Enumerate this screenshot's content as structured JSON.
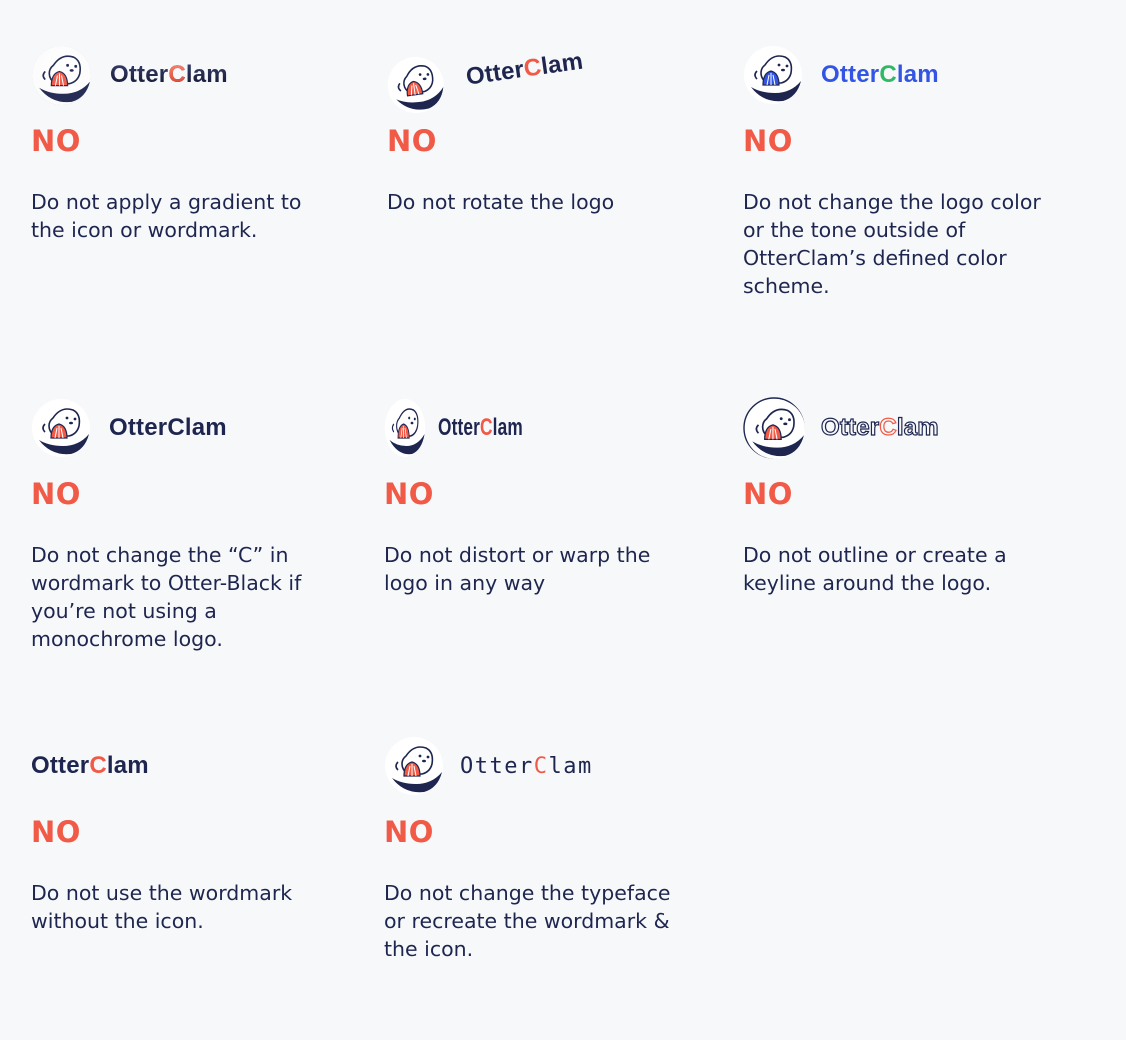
{
  "brand": {
    "wordmark_prefix": "Otter",
    "wordmark_c": "C",
    "wordmark_suffix": "lam",
    "colors": {
      "navy": "#1e2650",
      "coral": "#f05a46",
      "background": "#f7f8fa"
    }
  },
  "rules": [
    {
      "label": "NO",
      "description": "Do not apply a gradient to the icon or wordmark.",
      "icon": "otter-clam-icon"
    },
    {
      "label": "NO",
      "description": "Do not rotate the logo",
      "icon": "otter-clam-icon"
    },
    {
      "label": "NO",
      "description": "Do not change the logo color or the tone outside of OtterClam’s defined color scheme.",
      "icon": "otter-clam-icon"
    },
    {
      "label": "NO",
      "description": "Do not change the “C” in wordmark to Otter-Black if you’re not using a monochrome logo.",
      "icon": "otter-clam-icon"
    },
    {
      "label": "NO",
      "description": "Do not distort or warp the logo in any way",
      "icon": "otter-clam-icon"
    },
    {
      "label": "NO",
      "description": "Do not outline or create a keyline around the logo.",
      "icon": "otter-clam-icon"
    },
    {
      "label": "NO",
      "description": "Do not use the wordmark without the icon."
    },
    {
      "label": "NO",
      "description": "Do not change the typeface or recreate the wordmark & the icon.",
      "icon": "otter-clam-icon"
    }
  ]
}
